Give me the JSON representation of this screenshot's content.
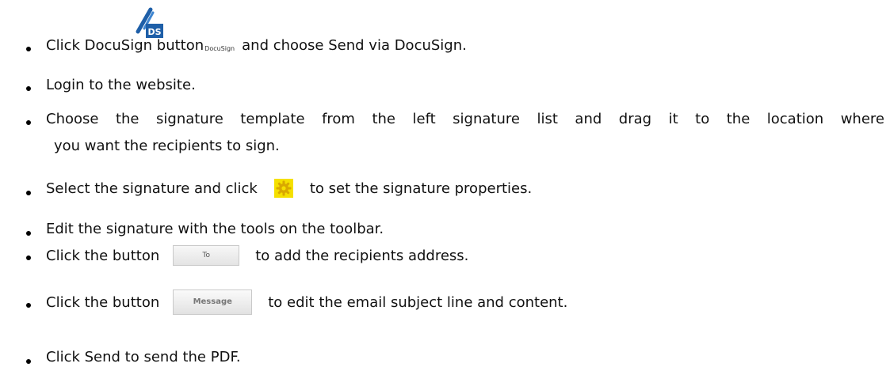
{
  "items": [
    {
      "text_before": "Click DocuSign button",
      "icon_label": "DocuSign",
      "icon_name": "docusign-pen-icon",
      "text_after": "and choose Send via DocuSign."
    },
    {
      "text": "Login to the website."
    },
    {
      "text_line1": "Choose the signature template from the left signature list and drag it to the location where",
      "text_line2": "you want the recipients to sign."
    },
    {
      "text_before": "Select the signature and click",
      "icon_name": "gear-icon",
      "text_after": "to set the signature properties."
    },
    {
      "text": "Edit the signature with the tools on the toolbar."
    },
    {
      "text_before": "Click the button",
      "button_label": "To",
      "text_after": "to add the recipients address."
    },
    {
      "text_before": "Click the button",
      "button_label": "Message",
      "text_after": "to edit the email subject line and content."
    },
    {
      "text": "Click Send to send the PDF."
    }
  ],
  "colors": {
    "gear_background": "#f5e000",
    "docusign_blue": "#1e5fa8"
  }
}
